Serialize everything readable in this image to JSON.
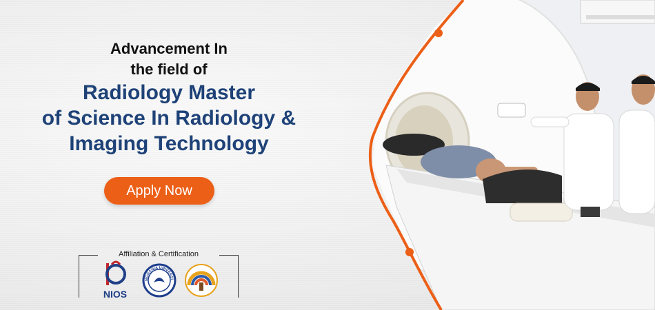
{
  "banner": {
    "headline_line1": "Advancement In",
    "headline_line2": "the field of",
    "title_line1": "Radiology Master",
    "title_line2": "of Science In Radiology &",
    "title_line3": "Imaging Technology",
    "cta_label": "Apply Now",
    "affiliation_label": "Affiliation & Certification",
    "logos": [
      {
        "name": "NIOS",
        "text": "NIOS"
      },
      {
        "name": "Singhania University",
        "text": "SINGHANIA UNIVERSITY"
      },
      {
        "name": "Mansarovar University",
        "text": ""
      }
    ]
  },
  "colors": {
    "accent_orange": "#ec5f17",
    "title_blue": "#1e4278",
    "text_dark": "#111111"
  }
}
